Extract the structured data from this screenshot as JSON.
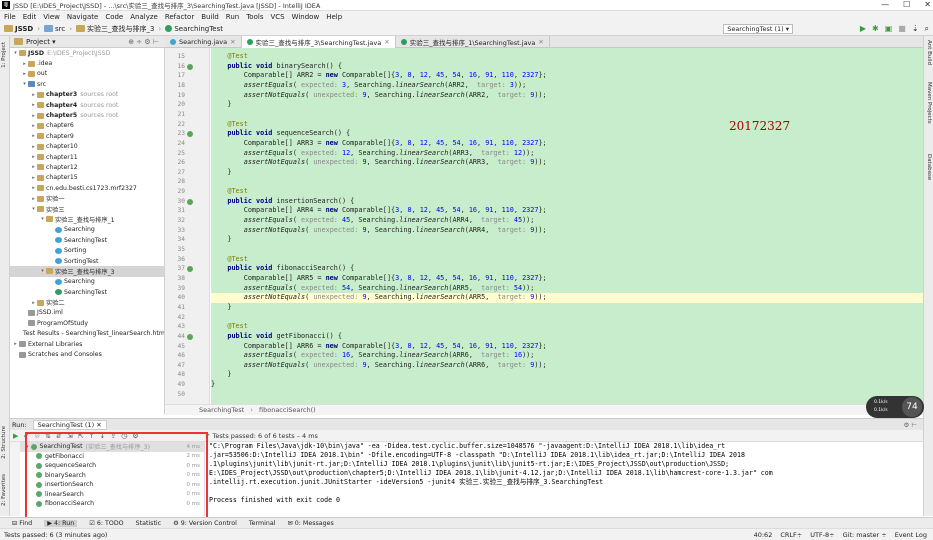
{
  "window": {
    "title": "JSSD [E:\\IDES_Project\\JSSD] - ...\\src\\实验三_查找与排序_3\\SearchingTest.java [JSSD] - IntelliJ IDEA",
    "app_icon": "IJ",
    "min": "—",
    "max": "☐",
    "close": "✕"
  },
  "menu": [
    "File",
    "Edit",
    "View",
    "Navigate",
    "Code",
    "Analyze",
    "Refactor",
    "Build",
    "Run",
    "Tools",
    "VCS",
    "Window",
    "Help"
  ],
  "nav": {
    "crumbs": [
      "JSSD",
      "src",
      "实验三_查找与排序_3",
      "SearchingTest"
    ],
    "run_config": "SearchingTest (1) ▾"
  },
  "project": {
    "header": "Project ▾",
    "tree": [
      {
        "d": 0,
        "a": "▾",
        "ic": "f",
        "t": "JSSD",
        "s": "E:\\IDES_Project\\JSSD",
        "b": true
      },
      {
        "d": 1,
        "a": "▸",
        "ic": "f",
        "t": ".idea"
      },
      {
        "d": 1,
        "a": "▸",
        "ic": "f",
        "t": "out"
      },
      {
        "d": 1,
        "a": "▾",
        "ic": "fb",
        "t": "src"
      },
      {
        "d": 2,
        "a": "▸",
        "ic": "f",
        "t": "chapter3",
        "s": "sources root",
        "b": true
      },
      {
        "d": 2,
        "a": "▸",
        "ic": "f",
        "t": "chapter4",
        "s": "sources root",
        "b": true
      },
      {
        "d": 2,
        "a": "▸",
        "ic": "f",
        "t": "chapter5",
        "s": "sources root",
        "b": true
      },
      {
        "d": 2,
        "a": "▸",
        "ic": "f",
        "t": "chapter6"
      },
      {
        "d": 2,
        "a": "▸",
        "ic": "f",
        "t": "chapter9"
      },
      {
        "d": 2,
        "a": "▸",
        "ic": "f",
        "t": "chapter10"
      },
      {
        "d": 2,
        "a": "▸",
        "ic": "f",
        "t": "chapter11"
      },
      {
        "d": 2,
        "a": "▸",
        "ic": "f",
        "t": "chapter12"
      },
      {
        "d": 2,
        "a": "▸",
        "ic": "f",
        "t": "chapter15"
      },
      {
        "d": 2,
        "a": "▸",
        "ic": "f",
        "t": "cn.edu.besti.cs1723.mrf2327"
      },
      {
        "d": 2,
        "a": "▸",
        "ic": "f",
        "t": "实验一"
      },
      {
        "d": 2,
        "a": "▾",
        "ic": "f",
        "t": "实验三"
      },
      {
        "d": 3,
        "a": "▾",
        "ic": "f",
        "t": "实验三_查找与排序_1"
      },
      {
        "d": 4,
        "a": "",
        "ic": "c",
        "t": "Searching"
      },
      {
        "d": 4,
        "a": "",
        "ic": "c",
        "t": "SearchingTest"
      },
      {
        "d": 4,
        "a": "",
        "ic": "c",
        "t": "Sorting"
      },
      {
        "d": 4,
        "a": "",
        "ic": "c",
        "t": "SortingTest"
      },
      {
        "d": 3,
        "a": "▾",
        "ic": "f",
        "t": "实验三_查找与排序_3",
        "sel": true
      },
      {
        "d": 4,
        "a": "",
        "ic": "c",
        "t": "Searching"
      },
      {
        "d": 4,
        "a": "",
        "ic": "t",
        "t": "SearchingTest"
      },
      {
        "d": 2,
        "a": "▸",
        "ic": "f",
        "t": "实验二"
      },
      {
        "d": 1,
        "a": "",
        "ic": "x",
        "t": "JSSD.iml"
      },
      {
        "d": 1,
        "a": "",
        "ic": "x",
        "t": "ProgramOfStudy"
      },
      {
        "d": 1,
        "a": "",
        "ic": "t",
        "t": "Test Results - SearchingTest_linearSearch.html"
      },
      {
        "d": 0,
        "a": "▸",
        "ic": "x",
        "t": "External Libraries"
      },
      {
        "d": 0,
        "a": "",
        "ic": "x",
        "t": "Scratches and Consoles"
      }
    ]
  },
  "tabs": [
    {
      "label": "Searching.java",
      "active": false
    },
    {
      "label": "实验三_查找与排序_3\\SearchingTest.java",
      "active": true
    },
    {
      "label": "实验三_查找与排序_1\\SearchingTest.java",
      "active": false
    }
  ],
  "code": [
    {
      "n": "15",
      "h": "    <span class=\"an\">@Test</span>"
    },
    {
      "n": "16",
      "h": "    <span class=\"kw\">public void</span> binarySearch() {",
      "m": true
    },
    {
      "n": "17",
      "h": "        Comparable[] ARR2 = <span class=\"kw\">new</span> Comparable[]{<span class=\"num\">3</span>, <span class=\"num\">8</span>, <span class=\"num\">12</span>, <span class=\"num\">45</span>, <span class=\"num\">54</span>, <span class=\"num\">16</span>, <span class=\"num\">91</span>, <span class=\"num\">110</span>, <span class=\"num\">2327</span>};"
    },
    {
      "n": "18",
      "h": "        <span class=\"it\">assertEquals</span>( <span class=\"hint\">expected:</span> <span class=\"num\">3</span>, Searching.<span class=\"it\">linearSearch</span>(ARR2,  <span class=\"hint\">target:</span> <span class=\"num\">3</span>));"
    },
    {
      "n": "19",
      "h": "        <span class=\"it\">assertNotEquals</span>( <span class=\"hint\">unexpected:</span> <span class=\"num\">9</span>, Searching.<span class=\"it\">linearSearch</span>(ARR2,  <span class=\"hint\">target:</span> <span class=\"num\">9</span>));"
    },
    {
      "n": "20",
      "h": "    }"
    },
    {
      "n": "21",
      "h": ""
    },
    {
      "n": "22",
      "h": "    <span class=\"an\">@Test</span>"
    },
    {
      "n": "23",
      "h": "    <span class=\"kw\">public void</span> sequenceSearch() {",
      "m": true
    },
    {
      "n": "24",
      "h": "        Comparable[] ARR3 = <span class=\"kw\">new</span> Comparable[]{<span class=\"num\">3</span>, <span class=\"num\">8</span>, <span class=\"num\">12</span>, <span class=\"num\">45</span>, <span class=\"num\">54</span>, <span class=\"num\">16</span>, <span class=\"num\">91</span>, <span class=\"num\">110</span>, <span class=\"num\">2327</span>};"
    },
    {
      "n": "25",
      "h": "        <span class=\"it\">assertEquals</span>( <span class=\"hint\">expected:</span> <span class=\"num\">12</span>, Searching.<span class=\"it\">linearSearch</span>(ARR3,  <span class=\"hint\">target:</span> <span class=\"num\">12</span>));"
    },
    {
      "n": "26",
      "h": "        <span class=\"it\">assertNotEquals</span>( <span class=\"hint\">unexpected:</span> <span class=\"num\">9</span>, Searching.<span class=\"it\">linearSearch</span>(ARR3,  <span class=\"hint\">target:</span> <span class=\"num\">9</span>));"
    },
    {
      "n": "27",
      "h": "    }"
    },
    {
      "n": "28",
      "h": ""
    },
    {
      "n": "29",
      "h": "    <span class=\"an\">@Test</span>"
    },
    {
      "n": "30",
      "h": "    <span class=\"kw\">public void</span> insertionSearch() {",
      "m": true
    },
    {
      "n": "31",
      "h": "        Comparable[] ARR4 = <span class=\"kw\">new</span> Comparable[]{<span class=\"num\">3</span>, <span class=\"num\">8</span>, <span class=\"num\">12</span>, <span class=\"num\">45</span>, <span class=\"num\">54</span>, <span class=\"num\">16</span>, <span class=\"num\">91</span>, <span class=\"num\">110</span>, <span class=\"num\">2327</span>};"
    },
    {
      "n": "32",
      "h": "        <span class=\"it\">assertEquals</span>( <span class=\"hint\">expected:</span> <span class=\"num\">45</span>, Searching.<span class=\"it\">linearSearch</span>(ARR4,  <span class=\"hint\">target:</span> <span class=\"num\">45</span>));"
    },
    {
      "n": "33",
      "h": "        <span class=\"it\">assertNotEquals</span>( <span class=\"hint\">unexpected:</span> <span class=\"num\">9</span>, Searching.<span class=\"it\">linearSearch</span>(ARR4,  <span class=\"hint\">target:</span> <span class=\"num\">9</span>));"
    },
    {
      "n": "34",
      "h": "    }"
    },
    {
      "n": "35",
      "h": ""
    },
    {
      "n": "36",
      "h": "    <span class=\"an\">@Test</span>"
    },
    {
      "n": "37",
      "h": "    <span class=\"kw\">public void</span> fibonacciSearch() {",
      "m": true
    },
    {
      "n": "38",
      "h": "        Comparable[] ARR5 = <span class=\"kw\">new</span> Comparable[]{<span class=\"num\">3</span>, <span class=\"num\">8</span>, <span class=\"num\">12</span>, <span class=\"num\">45</span>, <span class=\"num\">54</span>, <span class=\"num\">16</span>, <span class=\"num\">91</span>, <span class=\"num\">110</span>, <span class=\"num\">2327</span>};"
    },
    {
      "n": "39",
      "h": "        <span class=\"it\">assertEquals</span>( <span class=\"hint\">expected:</span> <span class=\"num\">54</span>, Searching.<span class=\"it\">linearSearch</span>(ARR5,  <span class=\"hint\">target:</span> <span class=\"num\">54</span>));"
    },
    {
      "n": "40",
      "h": "        <span class=\"it\">assertNotEquals</span>( <span class=\"hint\">unexpected:</span> <span class=\"num\">9</span>, Searching.<span class=\"it\">linearSearch</span>(ARR5,  <span class=\"hint\">target:</span> <span class=\"num\">9</span>));",
      "cur": true
    },
    {
      "n": "41",
      "h": "    }"
    },
    {
      "n": "42",
      "h": ""
    },
    {
      "n": "43",
      "h": "    <span class=\"an\">@Test</span>"
    },
    {
      "n": "44",
      "h": "    <span class=\"kw\">public void</span> getFibonacci() {",
      "m": true
    },
    {
      "n": "45",
      "h": "        Comparable[] ARR6 = <span class=\"kw\">new</span> Comparable[]{<span class=\"num\">3</span>, <span class=\"num\">8</span>, <span class=\"num\">12</span>, <span class=\"num\">45</span>, <span class=\"num\">54</span>, <span class=\"num\">16</span>, <span class=\"num\">91</span>, <span class=\"num\">110</span>, <span class=\"num\">2327</span>};"
    },
    {
      "n": "46",
      "h": "        <span class=\"it\">assertEquals</span>( <span class=\"hint\">expected:</span> <span class=\"num\">16</span>, Searching.<span class=\"it\">linearSearch</span>(ARR6,  <span class=\"hint\">target:</span> <span class=\"num\">16</span>));"
    },
    {
      "n": "47",
      "h": "        <span class=\"it\">assertNotEquals</span>( <span class=\"hint\">unexpected:</span> <span class=\"num\">9</span>, Searching.<span class=\"it\">linearSearch</span>(ARR6,  <span class=\"hint\">target:</span> <span class=\"num\">9</span>));"
    },
    {
      "n": "48",
      "h": "    }"
    },
    {
      "n": "49",
      "h": "}"
    },
    {
      "n": "50",
      "h": ""
    }
  ],
  "watermark": "20172327",
  "breadcrumb": [
    "SearchingTest",
    "fibonacciSearch()"
  ],
  "perf": {
    "up": "0.1k/s",
    "down": "0.1k/s",
    "value": "74"
  },
  "run": {
    "label": "Run:",
    "tab": "SearchingTest (1)",
    "status": "Tests passed: 6 of 6 tests – 4 ms"
  },
  "tests": [
    {
      "t": "SearchingTest",
      "s": "(实验三_查找与排序_3)",
      "ms": "4 ms",
      "root": true
    },
    {
      "t": "getFibonacci",
      "ms": "2 ms"
    },
    {
      "t": "sequenceSearch",
      "ms": "0 ms"
    },
    {
      "t": "binarySearch",
      "ms": "0 ms"
    },
    {
      "t": "insertionSearch",
      "ms": "0 ms"
    },
    {
      "t": "linearSearch",
      "ms": "0 ms"
    },
    {
      "t": "fibonacciSearch",
      "ms": "0 ms"
    }
  ],
  "console": "\"C:\\Program Files\\Java\\jdk-10\\bin\\java\" -ea -Didea.test.cyclic.buffer.size=1048576 \"-javaagent:D:\\IntelliJ IDEA 2018.1\\lib\\idea_rt\n.jar=53506:D:\\IntelliJ IDEA 2018.1\\bin\" -Dfile.encoding=UTF-8 -classpath \"D:\\IntelliJ IDEA 2018.1\\lib\\idea_rt.jar;D:\\IntelliJ IDEA 2018\n.1\\plugins\\junit\\lib\\junit-rt.jar;D:\\IntelliJ IDEA 2018.1\\plugins\\junit\\lib\\junit5-rt.jar;E:\\IDES_Project\\JSSD\\out\\production\\JSSD;\nE:\\IDES_Project\\JSSD\\out\\production\\chapter5;D:\\IntelliJ IDEA 2018.1\\lib\\junit-4.12.jar;D:\\IntelliJ IDEA 2018.1\\lib\\hamcrest-core-1.3.jar\" com\n.intellij.rt.execution.junit.JUnitStarter -ideVersion5 -junit4 实验三.实验三_查找与排序_3.SearchingTest\n\nProcess finished with exit code 0",
  "bottom_tools": [
    "⊟ Find",
    "▶ 4: Run",
    "☑ 6: TODO",
    "Statistic",
    "⚙ 9: Version Control",
    "Terminal",
    "✉ 0: Messages"
  ],
  "status": {
    "left": "Tests passed: 6 (3 minutes ago)",
    "right": [
      "40:62",
      "CRLF÷",
      "UTF-8÷",
      "Git: master ÷",
      "Event Log"
    ]
  },
  "side_left": [
    "1: Project",
    "2: Structure",
    "2: Favorites"
  ],
  "side_right": [
    "Ant Build",
    "Maven Projects",
    "Database"
  ]
}
